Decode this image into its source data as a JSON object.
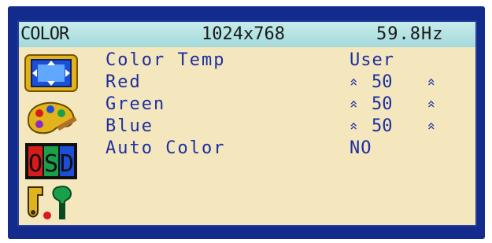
{
  "title_bar": {
    "menu_name": "COLOR",
    "resolution": "1024x768",
    "frequency": "59.8Hz"
  },
  "icons": [
    {
      "name": "display-position-icon"
    },
    {
      "name": "color-palette-icon"
    },
    {
      "name": "osd-settings-icon"
    },
    {
      "name": "tools-icon"
    }
  ],
  "menu": {
    "items": [
      {
        "label": "Color Temp",
        "value": "User"
      },
      {
        "label": "Red",
        "value": "50",
        "decrease": "«",
        "increase": "»"
      },
      {
        "label": "Green",
        "value": "50",
        "decrease": "«",
        "increase": "»"
      },
      {
        "label": "Blue",
        "value": "50",
        "decrease": "«",
        "increase": "»"
      },
      {
        "label": "Auto Color",
        "value": "NO"
      }
    ]
  },
  "colors": {
    "bezel": "#132b8c",
    "panel": "#f4e6bd",
    "title_bar": "#b3e2e2",
    "text": "#1c2fa0"
  }
}
